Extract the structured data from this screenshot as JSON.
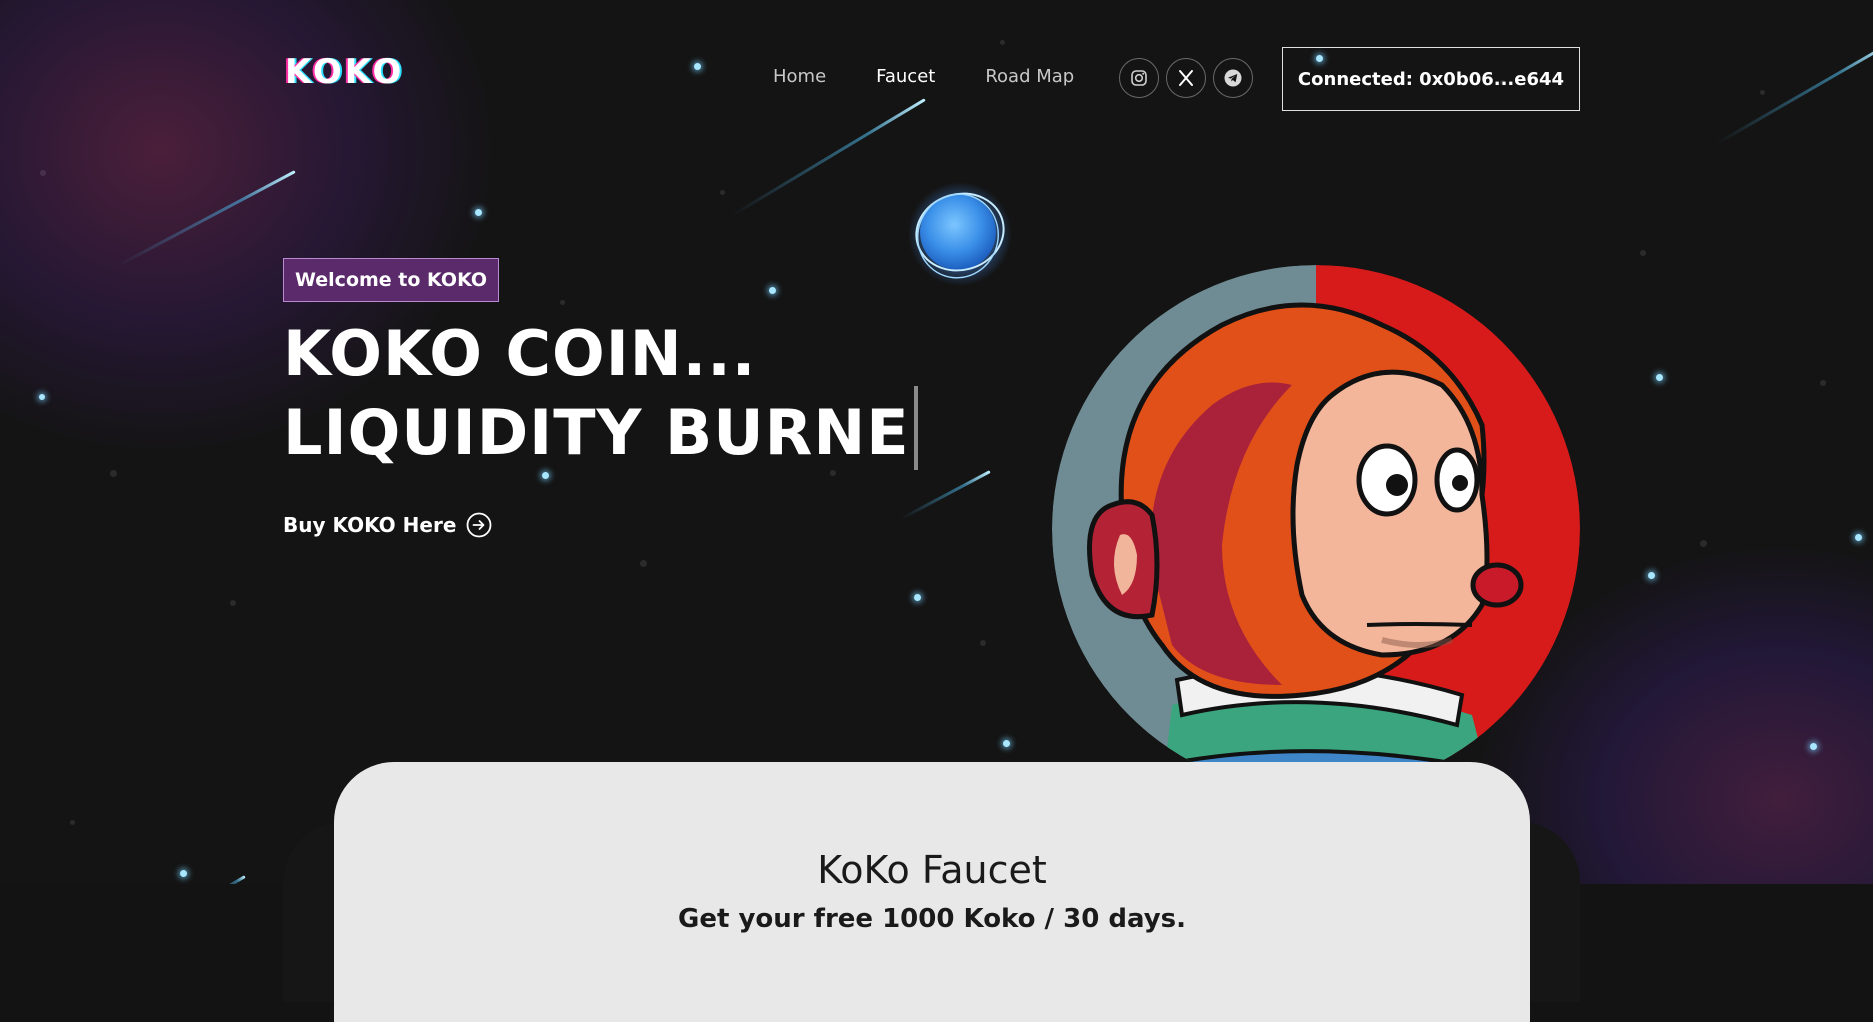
{
  "brand": {
    "logo": "KOKO"
  },
  "nav": {
    "items": [
      {
        "label": "Home",
        "active": false
      },
      {
        "label": "Faucet",
        "active": true
      },
      {
        "label": "Road Map",
        "active": false
      }
    ]
  },
  "socials": [
    {
      "icon": "instagram-icon"
    },
    {
      "icon": "x-icon"
    },
    {
      "icon": "telegram-icon"
    }
  ],
  "wallet": {
    "label": "Connected: 0x0b06...e644"
  },
  "hero": {
    "badge": "Welcome to KOKO",
    "headline_line1": "KOKO COIN...",
    "headline_line2": "LIQUIDITY BURNE",
    "cta_label": "Buy KOKO Here",
    "cta_icon": "arrow-right-circle-icon"
  },
  "faucet": {
    "title": "KoKo Faucet",
    "subtitle": "Get your free 1000 Koko / 30 days."
  },
  "colors": {
    "background": "#131313",
    "badge_bg": "#5a2a6a",
    "badge_border": "#b98ad0",
    "card_bg": "#e8e8e8",
    "mascot_left": "#6f8b93",
    "mascot_right": "#d71a1a",
    "star": "#a9e6ff"
  }
}
